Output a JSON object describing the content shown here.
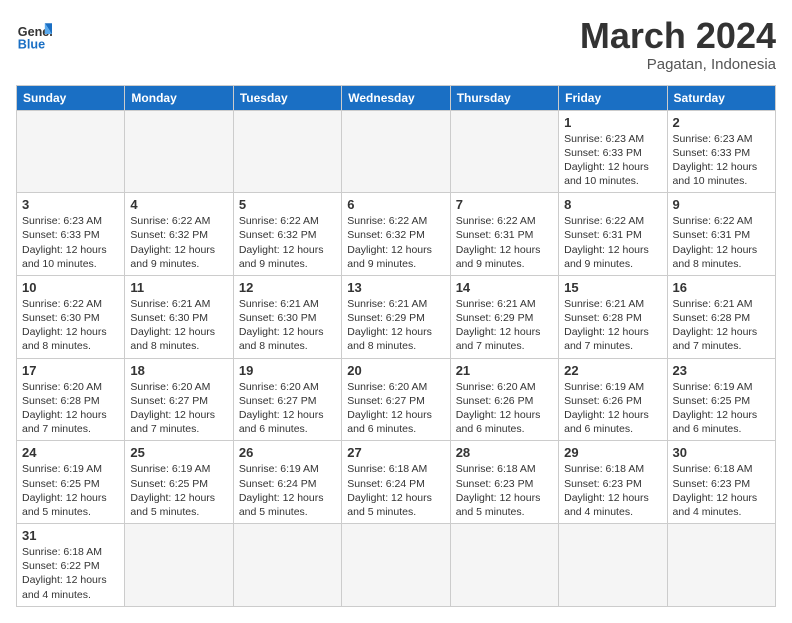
{
  "header": {
    "logo_general": "General",
    "logo_blue": "Blue",
    "month_title": "March 2024",
    "subtitle": "Pagatan, Indonesia"
  },
  "weekdays": [
    "Sunday",
    "Monday",
    "Tuesday",
    "Wednesday",
    "Thursday",
    "Friday",
    "Saturday"
  ],
  "weeks": [
    [
      {
        "day": "",
        "info": ""
      },
      {
        "day": "",
        "info": ""
      },
      {
        "day": "",
        "info": ""
      },
      {
        "day": "",
        "info": ""
      },
      {
        "day": "",
        "info": ""
      },
      {
        "day": "1",
        "info": "Sunrise: 6:23 AM\nSunset: 6:33 PM\nDaylight: 12 hours and 10 minutes."
      },
      {
        "day": "2",
        "info": "Sunrise: 6:23 AM\nSunset: 6:33 PM\nDaylight: 12 hours and 10 minutes."
      }
    ],
    [
      {
        "day": "3",
        "info": "Sunrise: 6:23 AM\nSunset: 6:33 PM\nDaylight: 12 hours and 10 minutes."
      },
      {
        "day": "4",
        "info": "Sunrise: 6:22 AM\nSunset: 6:32 PM\nDaylight: 12 hours and 9 minutes."
      },
      {
        "day": "5",
        "info": "Sunrise: 6:22 AM\nSunset: 6:32 PM\nDaylight: 12 hours and 9 minutes."
      },
      {
        "day": "6",
        "info": "Sunrise: 6:22 AM\nSunset: 6:32 PM\nDaylight: 12 hours and 9 minutes."
      },
      {
        "day": "7",
        "info": "Sunrise: 6:22 AM\nSunset: 6:31 PM\nDaylight: 12 hours and 9 minutes."
      },
      {
        "day": "8",
        "info": "Sunrise: 6:22 AM\nSunset: 6:31 PM\nDaylight: 12 hours and 9 minutes."
      },
      {
        "day": "9",
        "info": "Sunrise: 6:22 AM\nSunset: 6:31 PM\nDaylight: 12 hours and 8 minutes."
      }
    ],
    [
      {
        "day": "10",
        "info": "Sunrise: 6:22 AM\nSunset: 6:30 PM\nDaylight: 12 hours and 8 minutes."
      },
      {
        "day": "11",
        "info": "Sunrise: 6:21 AM\nSunset: 6:30 PM\nDaylight: 12 hours and 8 minutes."
      },
      {
        "day": "12",
        "info": "Sunrise: 6:21 AM\nSunset: 6:30 PM\nDaylight: 12 hours and 8 minutes."
      },
      {
        "day": "13",
        "info": "Sunrise: 6:21 AM\nSunset: 6:29 PM\nDaylight: 12 hours and 8 minutes."
      },
      {
        "day": "14",
        "info": "Sunrise: 6:21 AM\nSunset: 6:29 PM\nDaylight: 12 hours and 7 minutes."
      },
      {
        "day": "15",
        "info": "Sunrise: 6:21 AM\nSunset: 6:28 PM\nDaylight: 12 hours and 7 minutes."
      },
      {
        "day": "16",
        "info": "Sunrise: 6:21 AM\nSunset: 6:28 PM\nDaylight: 12 hours and 7 minutes."
      }
    ],
    [
      {
        "day": "17",
        "info": "Sunrise: 6:20 AM\nSunset: 6:28 PM\nDaylight: 12 hours and 7 minutes."
      },
      {
        "day": "18",
        "info": "Sunrise: 6:20 AM\nSunset: 6:27 PM\nDaylight: 12 hours and 7 minutes."
      },
      {
        "day": "19",
        "info": "Sunrise: 6:20 AM\nSunset: 6:27 PM\nDaylight: 12 hours and 6 minutes."
      },
      {
        "day": "20",
        "info": "Sunrise: 6:20 AM\nSunset: 6:27 PM\nDaylight: 12 hours and 6 minutes."
      },
      {
        "day": "21",
        "info": "Sunrise: 6:20 AM\nSunset: 6:26 PM\nDaylight: 12 hours and 6 minutes."
      },
      {
        "day": "22",
        "info": "Sunrise: 6:19 AM\nSunset: 6:26 PM\nDaylight: 12 hours and 6 minutes."
      },
      {
        "day": "23",
        "info": "Sunrise: 6:19 AM\nSunset: 6:25 PM\nDaylight: 12 hours and 6 minutes."
      }
    ],
    [
      {
        "day": "24",
        "info": "Sunrise: 6:19 AM\nSunset: 6:25 PM\nDaylight: 12 hours and 5 minutes."
      },
      {
        "day": "25",
        "info": "Sunrise: 6:19 AM\nSunset: 6:25 PM\nDaylight: 12 hours and 5 minutes."
      },
      {
        "day": "26",
        "info": "Sunrise: 6:19 AM\nSunset: 6:24 PM\nDaylight: 12 hours and 5 minutes."
      },
      {
        "day": "27",
        "info": "Sunrise: 6:18 AM\nSunset: 6:24 PM\nDaylight: 12 hours and 5 minutes."
      },
      {
        "day": "28",
        "info": "Sunrise: 6:18 AM\nSunset: 6:23 PM\nDaylight: 12 hours and 5 minutes."
      },
      {
        "day": "29",
        "info": "Sunrise: 6:18 AM\nSunset: 6:23 PM\nDaylight: 12 hours and 4 minutes."
      },
      {
        "day": "30",
        "info": "Sunrise: 6:18 AM\nSunset: 6:23 PM\nDaylight: 12 hours and 4 minutes."
      }
    ],
    [
      {
        "day": "31",
        "info": "Sunrise: 6:18 AM\nSunset: 6:22 PM\nDaylight: 12 hours and 4 minutes."
      },
      {
        "day": "",
        "info": ""
      },
      {
        "day": "",
        "info": ""
      },
      {
        "day": "",
        "info": ""
      },
      {
        "day": "",
        "info": ""
      },
      {
        "day": "",
        "info": ""
      },
      {
        "day": "",
        "info": ""
      }
    ]
  ]
}
